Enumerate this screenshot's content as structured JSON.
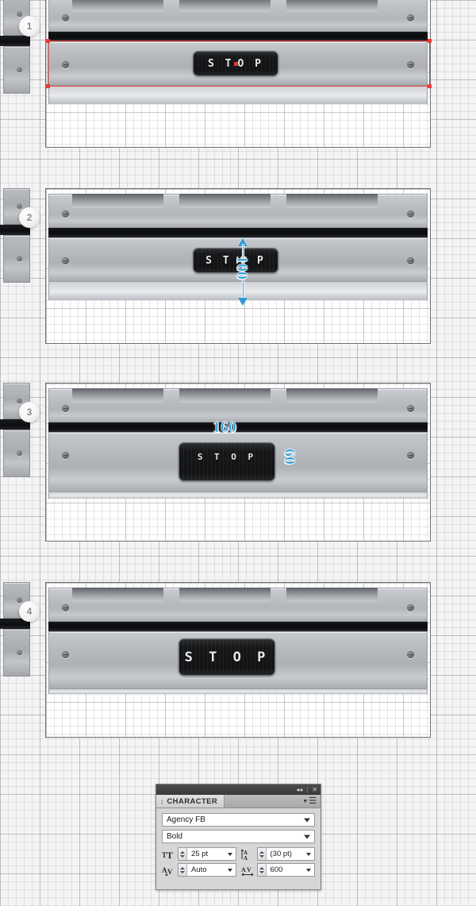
{
  "steps": [
    {
      "badge": "1",
      "screen_text_before": "S T",
      "screen_text_after": "O P",
      "has_caret": true,
      "selection_visible": true,
      "annotations": []
    },
    {
      "badge": "2",
      "screen_text": "S T O P",
      "has_caret": false,
      "selection_visible": false,
      "annotations": [
        {
          "name": "height-measure",
          "value": "100",
          "orientation": "vertical",
          "arrow": true
        }
      ]
    },
    {
      "badge": "3",
      "screen_text": "S T O P",
      "has_caret": false,
      "selection_visible": false,
      "annotations": [
        {
          "name": "width-measure",
          "value": "160",
          "orientation": "horizontal",
          "arrow": false
        },
        {
          "name": "height-measure",
          "value": "60",
          "orientation": "vertical",
          "arrow": false
        }
      ]
    },
    {
      "badge": "4",
      "screen_text": "S T O P",
      "has_caret": false,
      "selection_visible": false,
      "annotations": []
    }
  ],
  "character_panel": {
    "tab_label": "CHARACTER",
    "grip_icon": "updown-grip-icon",
    "menu_icon": "panel-menu-icon",
    "collapse_icon": "◂◂",
    "close_icon": "✕",
    "font_family": "Agency FB",
    "font_style": "Bold",
    "fields": [
      {
        "name": "font-size",
        "icon": "font-size-icon",
        "value": "25 pt",
        "spinner": true,
        "dropdown": true
      },
      {
        "name": "leading",
        "icon": "leading-icon",
        "value": "(30 pt)",
        "spinner": true,
        "dropdown": true
      },
      {
        "name": "kerning",
        "icon": "kerning-icon",
        "value": "Auto",
        "spinner": true,
        "dropdown": true
      },
      {
        "name": "tracking",
        "icon": "tracking-icon",
        "value": "600",
        "spinner": true,
        "dropdown": true
      }
    ]
  },
  "colors": {
    "accent_blue": "#2d9bd6",
    "selection_red": "#f03a32",
    "caret_red": "#e03a30",
    "screen_black": "#161718",
    "metal_light": "#c9ccd0",
    "panel_gray": "#d6d6d6"
  }
}
